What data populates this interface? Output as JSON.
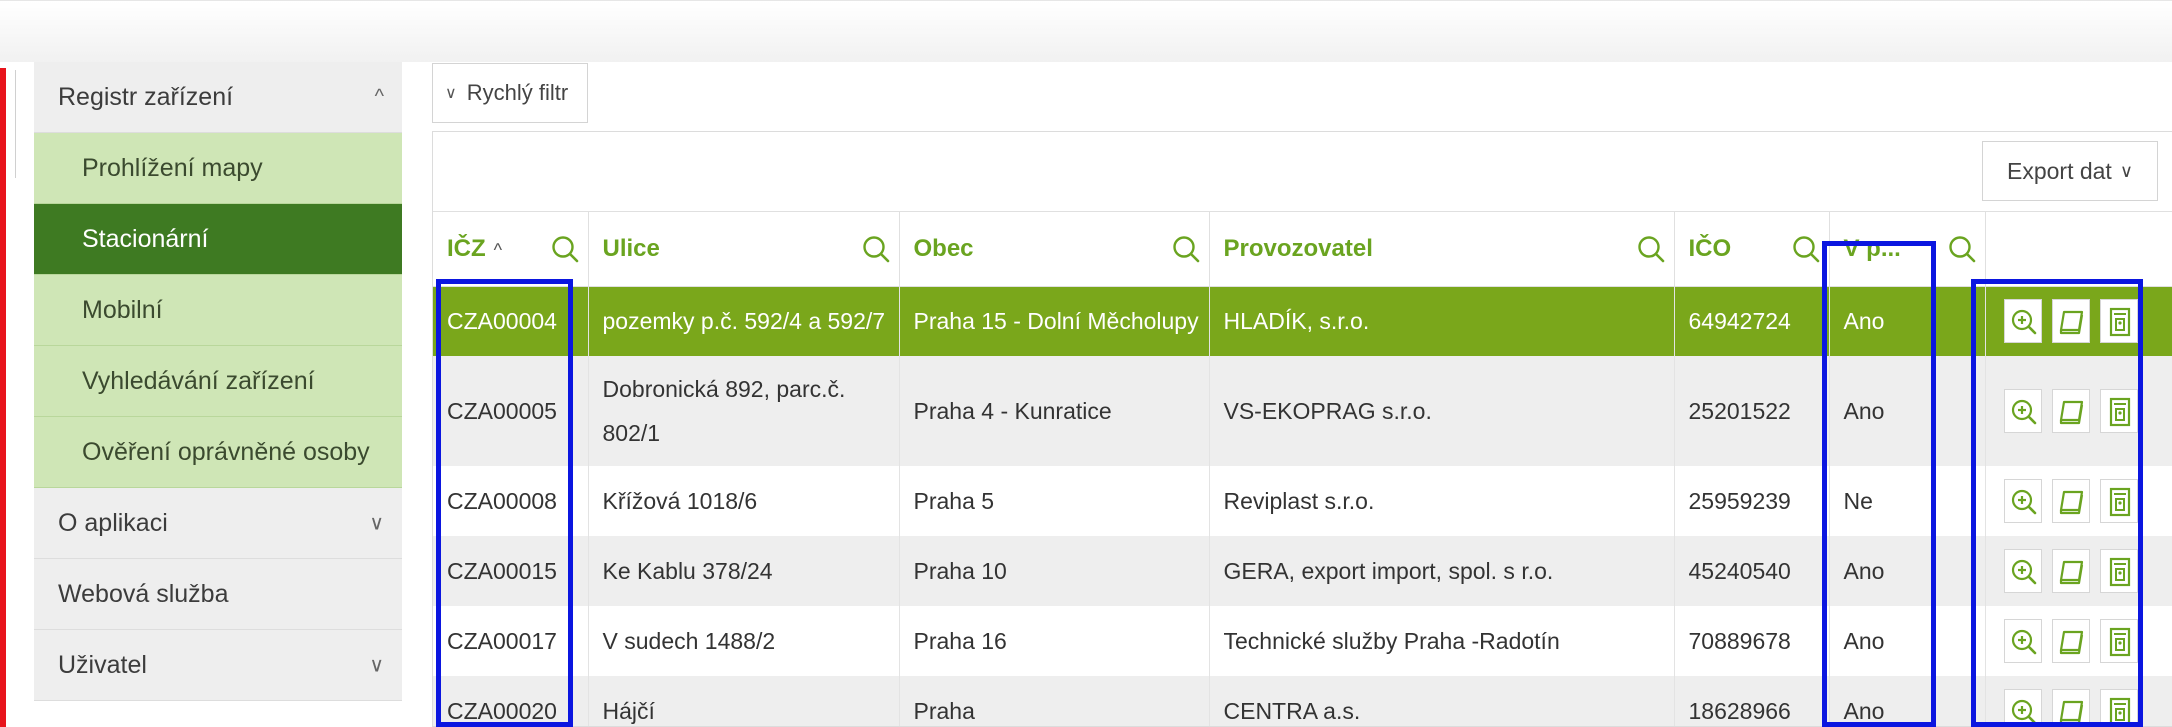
{
  "sidebar": {
    "items": [
      {
        "label": "Registr zařízení",
        "kind": "parent",
        "chevron": "up"
      },
      {
        "label": "Prohlížení mapy",
        "kind": "sub"
      },
      {
        "label": "Stacionární",
        "kind": "sub",
        "active": true
      },
      {
        "label": "Mobilní",
        "kind": "sub"
      },
      {
        "label": "Vyhledávání zařízení",
        "kind": "sub"
      },
      {
        "label": "Ověření oprávněné osoby",
        "kind": "sub"
      },
      {
        "label": "O aplikaci",
        "kind": "parent",
        "chevron": "down"
      },
      {
        "label": "Webová služba",
        "kind": "parent"
      },
      {
        "label": "Uživatel",
        "kind": "parent",
        "chevron": "down"
      }
    ]
  },
  "quick_filter": {
    "label": "Rychlý filtr"
  },
  "toolbar": {
    "export_label": "Export dat"
  },
  "table": {
    "columns": [
      "IČZ",
      "Ulice",
      "Obec",
      "Provozovatel",
      "IČO",
      "V p..."
    ],
    "sort_indicator": "^",
    "rows": [
      {
        "icz": "CZA00004",
        "ulice": "pozemky p.č. 592/4 a 592/7",
        "obec": "Praha 15 - Dolní Měcholupy",
        "provozovatel": "HLADÍK, s.r.o.",
        "ico": "64942724",
        "vp": "Ano"
      },
      {
        "icz": "CZA00005",
        "ulice": "Dobronická 892, parc.č. 802/1",
        "obec": "Praha 4 - Kunratice",
        "provozovatel": "VS-EKOPRAG s.r.o.",
        "ico": "25201522",
        "vp": "Ano"
      },
      {
        "icz": "CZA00008",
        "ulice": "Křížová 1018/6",
        "obec": "Praha 5",
        "provozovatel": "Reviplast s.r.o.",
        "ico": "25959239",
        "vp": "Ne"
      },
      {
        "icz": "CZA00015",
        "ulice": "Ke Kablu 378/24",
        "obec": "Praha 10",
        "provozovatel": "GERA, export import, spol. s r.o.",
        "ico": "45240540",
        "vp": "Ano"
      },
      {
        "icz": "CZA00017",
        "ulice": "V sudech 1488/2",
        "obec": "Praha 16",
        "provozovatel": "Technické služby Praha -Radotín",
        "ico": "70889678",
        "vp": "Ano"
      },
      {
        "icz": "CZA00020",
        "ulice": "Hájčí",
        "obec": "Praha",
        "provozovatel": "CENTRA a.s.",
        "ico": "18628966",
        "vp": "Ano"
      }
    ]
  },
  "colors": {
    "accent_green": "#6aa420",
    "selected_row": "#7aa71b",
    "sidebar_active": "#3e7a22",
    "sidebar_sub": "#cfe6b6",
    "highlight_blue": "#0b16e0",
    "edge_red": "#e8141c"
  },
  "icons": {
    "header_filter": "search-icon",
    "row_actions": [
      "zoom-in-icon",
      "book-icon",
      "document-icon"
    ]
  }
}
